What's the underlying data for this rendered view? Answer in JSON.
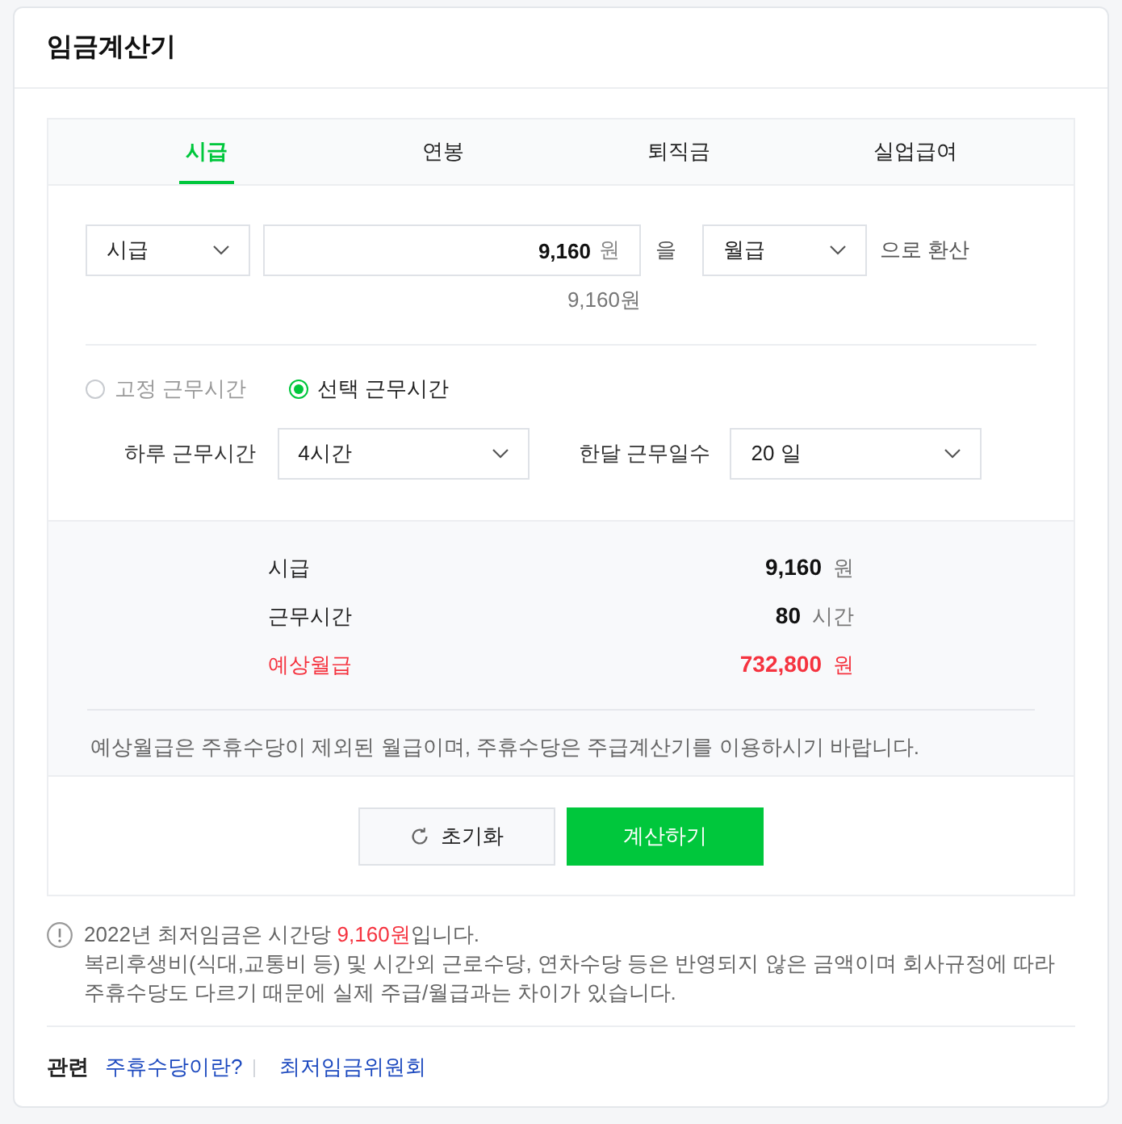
{
  "header": {
    "title": "임금계산기"
  },
  "tabs": [
    {
      "label": "시급",
      "selected": true
    },
    {
      "label": "연봉",
      "selected": false
    },
    {
      "label": "퇴직금",
      "selected": false
    },
    {
      "label": "실업급여",
      "selected": false
    }
  ],
  "converter": {
    "from_select": "시급",
    "amount": {
      "value": "9,160",
      "unit": "원"
    },
    "particle": "을",
    "to_select": "월급",
    "suffix": "으로 환산",
    "amount_readout": "9,160원"
  },
  "work_type": [
    {
      "label": "고정 근무시간",
      "selected": false
    },
    {
      "label": "선택 근무시간",
      "selected": true
    }
  ],
  "work_fields": [
    {
      "label": "하루 근무시간",
      "value": "4시간"
    },
    {
      "label": "한달 근무일수",
      "value": "20 일"
    }
  ],
  "results": [
    {
      "label": "시급",
      "value": "9,160",
      "unit": "원",
      "highlight": false
    },
    {
      "label": "근무시간",
      "value": "80",
      "unit": "시간",
      "highlight": false
    },
    {
      "label": "예상월급",
      "value": "732,800",
      "unit": "원",
      "highlight": true
    }
  ],
  "results_note": "예상월급은 주휴수당이 제외된 월급이며, 주휴수당은 주급계산기를 이용하시기 바랍니다.",
  "buttons": [
    {
      "kind": "reset",
      "label": "초기화"
    },
    {
      "kind": "primary",
      "label": "계산하기"
    }
  ],
  "notice": {
    "before": "2022년 최저임금은 시간당",
    "highlight": "9,160원",
    "after": "입니다.",
    "detail": "복리후생비(식대,교통비 등) 및 시간외 근로수당, 연차수당 등은 반영되지 않은 금액이며 회사규정에 따라 주휴수당도 다르기 때문에 실제 주급/월급과는 차이가 있습니다."
  },
  "related": {
    "label": "관련",
    "links": [
      "주휴수당이란?",
      "최저임금위원회"
    ]
  }
}
